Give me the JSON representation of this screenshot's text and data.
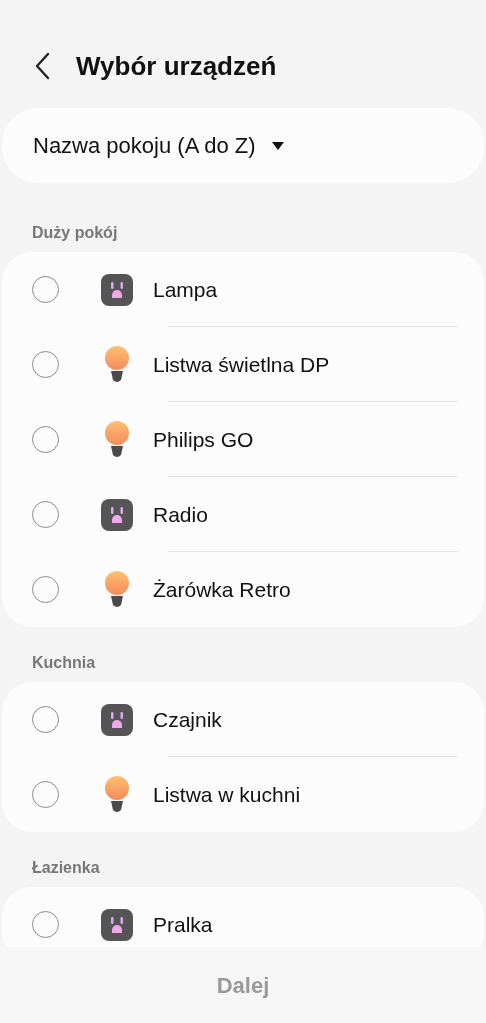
{
  "header": {
    "title": "Wybór urządzeń"
  },
  "sort": {
    "label": "Nazwa pokoju (A do Z)"
  },
  "sections": [
    {
      "title": "Duży pokój",
      "devices": [
        {
          "name": "Lampa",
          "kind": "plug",
          "selected": false
        },
        {
          "name": "Listwa świetlna DP",
          "kind": "bulb",
          "selected": false
        },
        {
          "name": "Philips GO",
          "kind": "bulb",
          "selected": false
        },
        {
          "name": "Radio",
          "kind": "plug",
          "selected": false
        },
        {
          "name": "Żarówka Retro",
          "kind": "bulb",
          "selected": false
        }
      ]
    },
    {
      "title": "Kuchnia",
      "devices": [
        {
          "name": "Czajnik",
          "kind": "plug",
          "selected": false
        },
        {
          "name": "Listwa w kuchni",
          "kind": "bulb",
          "selected": false
        }
      ]
    },
    {
      "title": "Łazienka",
      "devices": [
        {
          "name": "Pralka",
          "kind": "plug",
          "selected": false
        }
      ]
    }
  ],
  "next_button": {
    "label": "Dalej",
    "disabled": true
  }
}
